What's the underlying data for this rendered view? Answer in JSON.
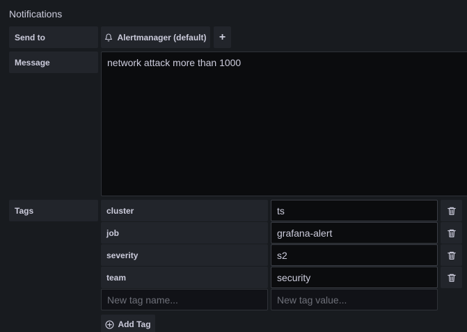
{
  "section": {
    "title": "Notifications"
  },
  "send_to": {
    "label": "Send to",
    "notifier_label": "Alertmanager (default)",
    "notifier_icon": "bell-icon",
    "add_icon": "+"
  },
  "message": {
    "label": "Message",
    "value": "network attack more than 1000"
  },
  "tags": {
    "label": "Tags",
    "items": [
      {
        "name": "cluster",
        "value": "ts"
      },
      {
        "name": "job",
        "value": "grafana-alert"
      },
      {
        "name": "severity",
        "value": "s2"
      },
      {
        "name": "team",
        "value": "security"
      }
    ],
    "new_name_placeholder": "New tag name...",
    "new_value_placeholder": "New tag value...",
    "add_label": "Add Tag"
  },
  "colors": {
    "background": "#181b1f",
    "field": "#22252b",
    "input": "#0b0c0e",
    "text": "#ccccdc"
  }
}
